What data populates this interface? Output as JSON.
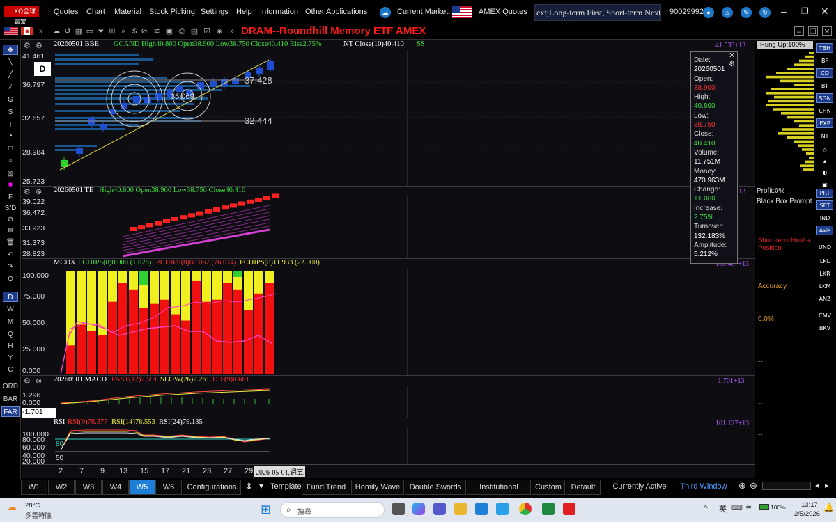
{
  "menubar": {
    "logo": "XQ全球贏家",
    "items": [
      "Quotes",
      "Chart",
      "Material",
      "Stock Picking",
      "Settings",
      "Help",
      "Information",
      "Other Applications"
    ],
    "market_label": "Current Market:",
    "market_value": "AMEX Quotes",
    "ticker": "ext;Long-term First, Short-term Next; Op",
    "account": "90029992"
  },
  "title": "DRAM--Roundhill Memory ETF  AMEX",
  "main_chart": {
    "header_date": "20260501 BBE",
    "header_gcand": "GCAND High40.800 Open38.900 Low38.750 Close40.410 Rise2.75%",
    "header_nt": "NT Close(10)40.410",
    "header_ss": "SS",
    "right_value": "41.533+13",
    "y_labels": [
      "41.461",
      "36.797",
      "32.657",
      "28.984",
      "25.723"
    ],
    "level_a": "37.428",
    "level_b": "32.444",
    "level_c": "35.069",
    "d_badge": "D",
    "hung_up": "Hung Up:100%"
  },
  "te_chart": {
    "header_date": "20260501 TE",
    "header_vals": "High40.800 Open38.900 Low38.750 Close40.410",
    "right_value": "39.104+13",
    "y_labels": [
      "39.022",
      "36.472",
      "33.923",
      "31.373",
      "28.823"
    ]
  },
  "mcdx_chart": {
    "header_name": "MCDX",
    "lc": "LCHIPS(8)0.000 (1.026)",
    "pc": "PCHIPS(8)88.067 (76.074)",
    "fc": "FCHIPS(8)11.933 (22.900)",
    "right_value": "100.467+13",
    "y_labels": [
      "100.000",
      "75.000",
      "50.000",
      "25.000",
      "0.000"
    ],
    "bars": [
      {
        "red": 28,
        "green": 0
      },
      {
        "red": 48,
        "green": 0
      },
      {
        "red": 42,
        "green": 0
      },
      {
        "red": 38,
        "green": 0
      },
      {
        "red": 70,
        "green": 0
      },
      {
        "red": 88,
        "green": 0
      },
      {
        "red": 82,
        "green": 0
      },
      {
        "red": 64,
        "green": 14
      },
      {
        "red": 68,
        "green": 0
      },
      {
        "red": 72,
        "green": 0
      },
      {
        "red": 58,
        "green": 0
      },
      {
        "red": 52,
        "green": 0
      },
      {
        "red": 90,
        "green": 0
      },
      {
        "red": 70,
        "green": 0
      },
      {
        "red": 72,
        "green": 0
      },
      {
        "red": 88,
        "green": 0
      },
      {
        "red": 82,
        "green": 6
      },
      {
        "red": 62,
        "green": 0
      },
      {
        "red": 78,
        "green": 0
      },
      {
        "red": 88,
        "green": 0
      }
    ]
  },
  "macd_chart": {
    "header_date": "20260501 MACD",
    "fast": "FAST(12)2.591",
    "slow": "SLOW(26)2.261",
    "dif": "DIF(9)0.661",
    "right_value": "-1.701+13",
    "y_labels": [
      "1.296",
      "0.000",
      "-1.701"
    ]
  },
  "rsi_chart": {
    "header_name": "RSI",
    "rsi9": "RSI(9)78.377",
    "rsi14": "RSI(14)78.553",
    "rsi24": "RSI(24)79.135",
    "right_value": "101.127+13",
    "y_labels": [
      "100.000",
      "80.000",
      "60.000",
      "40.000",
      "20.000"
    ],
    "marker_80": "80",
    "marker_50": "50"
  },
  "x_axis": {
    "ticks": [
      "2",
      "7",
      "9",
      "13",
      "15",
      "17",
      "21",
      "23",
      "27",
      "29"
    ],
    "cursor_label": "2026-05-01,週五"
  },
  "info_box": {
    "rows": [
      {
        "label": "Date:",
        "value": "20260501",
        "color": "#ffffff"
      },
      {
        "label": "Open:",
        "value": "38.900",
        "color": "#ff3030"
      },
      {
        "label": "High:",
        "value": "40.800",
        "color": "#40e040"
      },
      {
        "label": "Low:",
        "value": "38.750",
        "color": "#ff3030"
      },
      {
        "label": "Close:",
        "value": "40.410",
        "color": "#40e040"
      },
      {
        "label": "Volume:",
        "value": "11.751M",
        "color": "#ffffff"
      },
      {
        "label": "Money:",
        "value": "470.963M",
        "color": "#ffffff"
      },
      {
        "label": "Change:",
        "value": "+1.080",
        "color": "#40e040"
      },
      {
        "label": "Increase:",
        "value": "2.75%",
        "color": "#40e040"
      },
      {
        "label": "Turnover:",
        "value": "132.183%",
        "color": "#ffffff"
      },
      {
        "label": "Amplitude:",
        "value": "5.212%",
        "color": "#ffffff"
      }
    ]
  },
  "right_side_panel": {
    "profit": "Profit:0%",
    "black_box": "Black Box Prompt",
    "short_term": "Short-term Hold a Position",
    "accuracy": "Accuracy",
    "accuracy_value": "0.0%",
    "dash": "--"
  },
  "right_buttons": [
    "TBH",
    "BF",
    "CD",
    "BT",
    "SGN",
    "CHN",
    "EXP",
    "NT",
    "PRT",
    "SET",
    "IND",
    "Axis",
    "UND",
    "LKL",
    "LKR",
    "LKM",
    "ANZ",
    "CMV",
    "BKV"
  ],
  "left_period": [
    "D",
    "W",
    "M",
    "Q",
    "H",
    "Y",
    "C"
  ],
  "left_bottom": [
    "ORD",
    "BAR",
    "FAR"
  ],
  "bottom_tabs": [
    "W1",
    "W2",
    "W3",
    "W4",
    "W5",
    "W6",
    "Configurations",
    "Template",
    "Fund Trend",
    "Homily Wave",
    "Double Swords",
    "Institutional Arbitra",
    "Custom",
    "Default",
    "Currently Active Winc",
    "Third Window"
  ],
  "taskbar": {
    "temp": "28°C",
    "weather": "多雲時陰",
    "search": "搜尋",
    "lang": "英",
    "battery": "100%",
    "time": "13:17",
    "date": "2/5/2026"
  }
}
